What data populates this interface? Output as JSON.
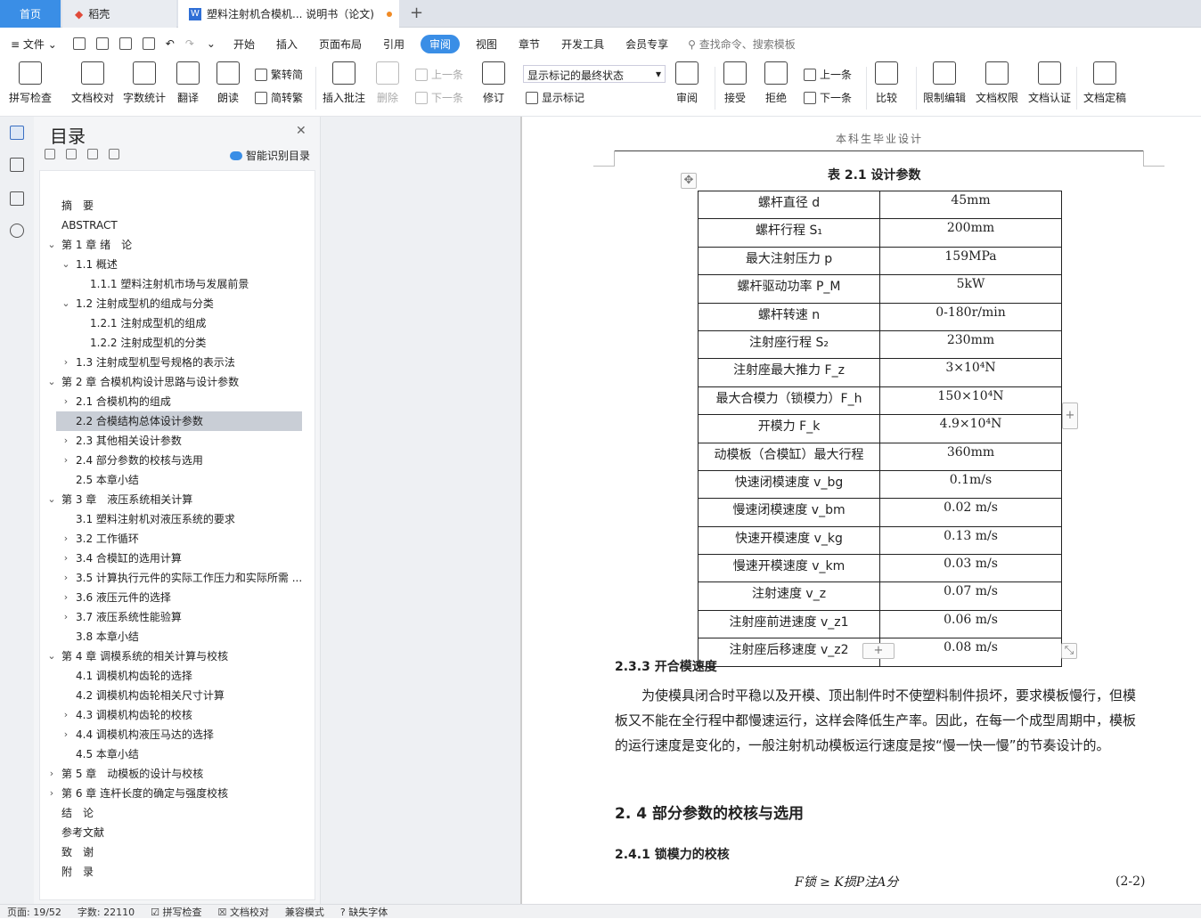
{
  "tabs": {
    "home": "首页",
    "daoke": "稻壳",
    "doc": "塑料注射机合模机... 说明书（论文)"
  },
  "menu": {
    "file": "文件",
    "items": [
      "开始",
      "插入",
      "页面布局",
      "引用",
      "审阅",
      "视图",
      "章节",
      "开发工具",
      "会员专享"
    ],
    "active": "审阅",
    "search": "查找命令、搜索模板"
  },
  "ribbon": {
    "spell": "拼写检查",
    "check": "文档校对",
    "count": "字数统计",
    "translate": "翻译",
    "read": "朗读",
    "trad": "繁转简",
    "simp": "简转繁",
    "comment": "插入批注",
    "delete": "删除",
    "prev": "上一条",
    "next": "下一条",
    "revise": "修订",
    "markup_state": "显示标记的最终状态",
    "show_markup": "显示标记",
    "review": "审阅",
    "accept": "接受",
    "reject": "拒绝",
    "prev2": "上一条",
    "next2": "下一条",
    "compare": "比较",
    "restrict": "限制编辑",
    "perm": "文档权限",
    "cert": "文档认证",
    "final": "文档定稿"
  },
  "toc": {
    "title": "目录",
    "smart": "智能识别目录",
    "items": [
      {
        "t": "摘　要",
        "l": 0,
        "a": ""
      },
      {
        "t": "ABSTRACT",
        "l": 0,
        "a": ""
      },
      {
        "t": "第 1 章 绪　论",
        "l": 0,
        "a": "v"
      },
      {
        "t": "1.1 概述",
        "l": 1,
        "a": "v"
      },
      {
        "t": "1.1.1 塑料注射机市场与发展前景",
        "l": 2,
        "a": ""
      },
      {
        "t": "1.2 注射成型机的组成与分类",
        "l": 1,
        "a": "v"
      },
      {
        "t": "1.2.1 注射成型机的组成",
        "l": 2,
        "a": ""
      },
      {
        "t": "1.2.2 注射成型机的分类",
        "l": 2,
        "a": ""
      },
      {
        "t": "1.3 注射成型机型号规格的表示法",
        "l": 1,
        "a": ">"
      },
      {
        "t": "第 2 章 合模机构设计思路与设计参数",
        "l": 0,
        "a": "v"
      },
      {
        "t": "2.1 合模机构的组成",
        "l": 1,
        "a": ">"
      },
      {
        "t": "2.2 合模结构总体设计参数",
        "l": 1,
        "a": ""
      },
      {
        "t": "2.3 其他相关设计参数",
        "l": 1,
        "a": ">"
      },
      {
        "t": "2.4 部分参数的校核与选用",
        "l": 1,
        "a": ">"
      },
      {
        "t": "2.5 本章小结",
        "l": 1,
        "a": ""
      },
      {
        "t": "第 3 章　液压系统相关计算",
        "l": 0,
        "a": "v"
      },
      {
        "t": "3.1 塑料注射机对液压系统的要求",
        "l": 1,
        "a": ""
      },
      {
        "t": "3.2 工作循环",
        "l": 1,
        "a": ">"
      },
      {
        "t": "3.4 合模缸的选用计算",
        "l": 1,
        "a": ">"
      },
      {
        "t": "3.5 计算执行元件的实际工作压力和实际所需 ...",
        "l": 1,
        "a": ">"
      },
      {
        "t": "3.6 液压元件的选择",
        "l": 1,
        "a": ">"
      },
      {
        "t": "3.7 液压系统性能验算",
        "l": 1,
        "a": ">"
      },
      {
        "t": "3.8 本章小结",
        "l": 1,
        "a": ""
      },
      {
        "t": "第 4 章 调模系统的相关计算与校核",
        "l": 0,
        "a": "v"
      },
      {
        "t": "4.1 调模机构齿轮的选择",
        "l": 1,
        "a": ""
      },
      {
        "t": "4.2 调模机构齿轮相关尺寸计算",
        "l": 1,
        "a": ""
      },
      {
        "t": "4.3 调模机构齿轮的校核",
        "l": 1,
        "a": ">"
      },
      {
        "t": "4.4 调模机构液压马达的选择",
        "l": 1,
        "a": ">"
      },
      {
        "t": "4.5 本章小结",
        "l": 1,
        "a": ""
      },
      {
        "t": "第 5 章　动模板的设计与校核",
        "l": 0,
        "a": ">"
      },
      {
        "t": "第 6 章 连杆长度的确定与强度校核",
        "l": 0,
        "a": ">"
      },
      {
        "t": "结　论",
        "l": 0,
        "a": ""
      },
      {
        "t": "参考文献",
        "l": 0,
        "a": ""
      },
      {
        "t": "致　谢",
        "l": 0,
        "a": ""
      },
      {
        "t": "附　录",
        "l": 0,
        "a": ""
      }
    ],
    "selected": 11
  },
  "doc": {
    "header": "本科生毕业设计",
    "table_caption": "表 2.1 设计参数",
    "table": [
      [
        "螺杆直径 d",
        "45mm"
      ],
      [
        "螺杆行程 S₁",
        "200mm"
      ],
      [
        "最大注射压力 p",
        "159MPa"
      ],
      [
        "螺杆驱动功率 P_M",
        "5kW"
      ],
      [
        "螺杆转速 n",
        "0-180r/min"
      ],
      [
        "注射座行程 S₂",
        "230mm"
      ],
      [
        "注射座最大推力 F_z",
        "3×10⁴N"
      ],
      [
        "最大合模力（锁模力）F_h",
        "150×10⁴N"
      ],
      [
        "开模力 F_k",
        "4.9×10⁴N"
      ],
      [
        "动模板（合模缸）最大行程",
        "360mm"
      ],
      [
        "快速闭模速度 v_bg",
        "0.1m/s"
      ],
      [
        "慢速闭模速度 v_bm",
        "0.02 m/s"
      ],
      [
        "快速开模速度 v_kg",
        "0.13 m/s"
      ],
      [
        "慢速开模速度 v_km",
        "0.03 m/s"
      ],
      [
        "注射速度 v_z",
        "0.07 m/s"
      ],
      [
        "注射座前进速度 v_z1",
        "0.06 m/s"
      ],
      [
        "注射座后移速度 v_z2",
        "0.08 m/s"
      ]
    ],
    "h_233": "2.3.3 开合模速度",
    "para": "为使模具闭合时平稳以及开模、顶出制件时不使塑料制件损坏，要求模板慢行，但模板又不能在全行程中都慢速运行，这样会降低生产率。因此，在每一个成型周期中，模板的运行速度是变化的，一般注射机动模板运行速度是按“慢一快一慢”的节奏设计的。",
    "h_24": "2. 4 部分参数的校核与选用",
    "h_241": "2.4.1 锁模力的校核",
    "formula": "F锁 ≥ K损P注A分",
    "eqno": "(2-2)"
  },
  "status": {
    "page": "页面: 19/52",
    "words": "字数: 22110",
    "spell": "拼写检查",
    "check": "文档校对",
    "compat": "兼容模式",
    "font": "缺失字体"
  }
}
